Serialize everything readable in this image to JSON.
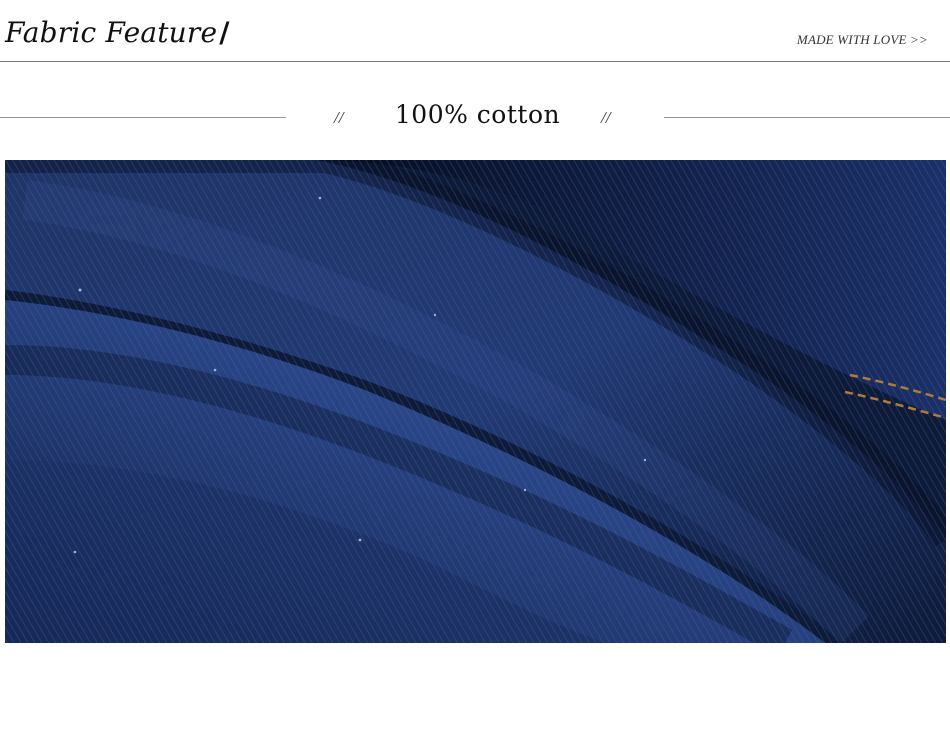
{
  "header": {
    "title": "Fabric Feature",
    "title_slash": "/",
    "tagline": "MADE WITH LOVE >>"
  },
  "section": {
    "mark_left": "//",
    "title": "100% cotton",
    "mark_right": "//"
  },
  "colors": {
    "denim_dark": "#0b1630",
    "denim_mid": "#1b2f5e",
    "denim_light": "#2a4686",
    "stitch": "#b07a3a",
    "rule": "#9a9a9a"
  }
}
